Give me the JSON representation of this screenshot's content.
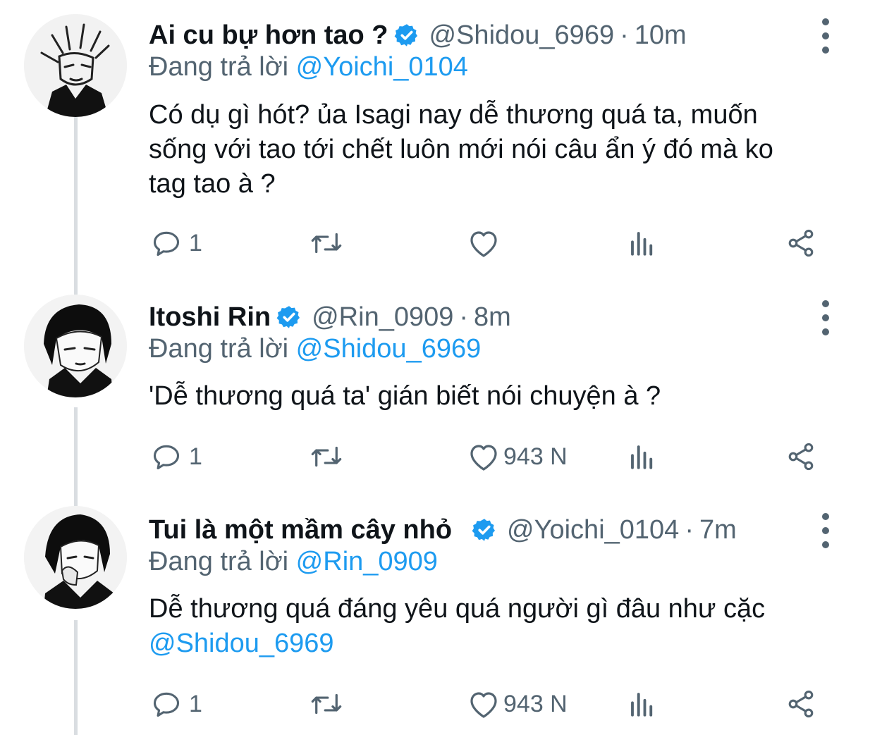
{
  "tweets": [
    {
      "display_name": "Ai cu bự hơn tao ?",
      "handle": "@Shidou_6969",
      "dot": "·",
      "time": "10m",
      "reply_prefix": "Đang trả lời",
      "reply_to": "@Yoichi_0104",
      "text_lines": [
        "Có dụ gì hót? ủa Isagi nay dễ thương quá ta, muốn",
        "sống với tao tới chết luôn mới nói câu ẩn ý đó mà ko",
        "tag tao à ?"
      ],
      "reply_count": "1",
      "like_count": ""
    },
    {
      "display_name": "Itoshi Rin",
      "handle": "@Rin_0909",
      "dot": "·",
      "time": "8m",
      "reply_prefix": "Đang trả lời",
      "reply_to": "@Shidou_6969",
      "text_lines": [
        "'Dễ thương quá ta' gián biết nói chuyện à ?"
      ],
      "reply_count": "1",
      "like_count": "943 N"
    },
    {
      "display_name": "Tui là một mầm cây nhỏ",
      "handle": "@Yoichi_0104",
      "dot": "·",
      "time": "7m",
      "reply_prefix": "Đang trả lời",
      "reply_to": "@Rin_0909",
      "text_lines": [
        "Dễ thương quá đáng yêu quá người gì đâu như cặc"
      ],
      "text_mention": "@Shidou_6969",
      "reply_count": "1",
      "like_count": "943 N"
    }
  ],
  "icons": {
    "verified": "verified-badge-icon",
    "more": "more-vertical-icon",
    "reply": "reply-icon",
    "retweet": "retweet-icon",
    "like": "heart-icon",
    "views": "views-icon",
    "share": "share-icon"
  },
  "colors": {
    "accent": "#1d9bf0",
    "secondary_text": "#536471",
    "primary_text": "#0f1419",
    "thread_line": "#d9dde1"
  }
}
